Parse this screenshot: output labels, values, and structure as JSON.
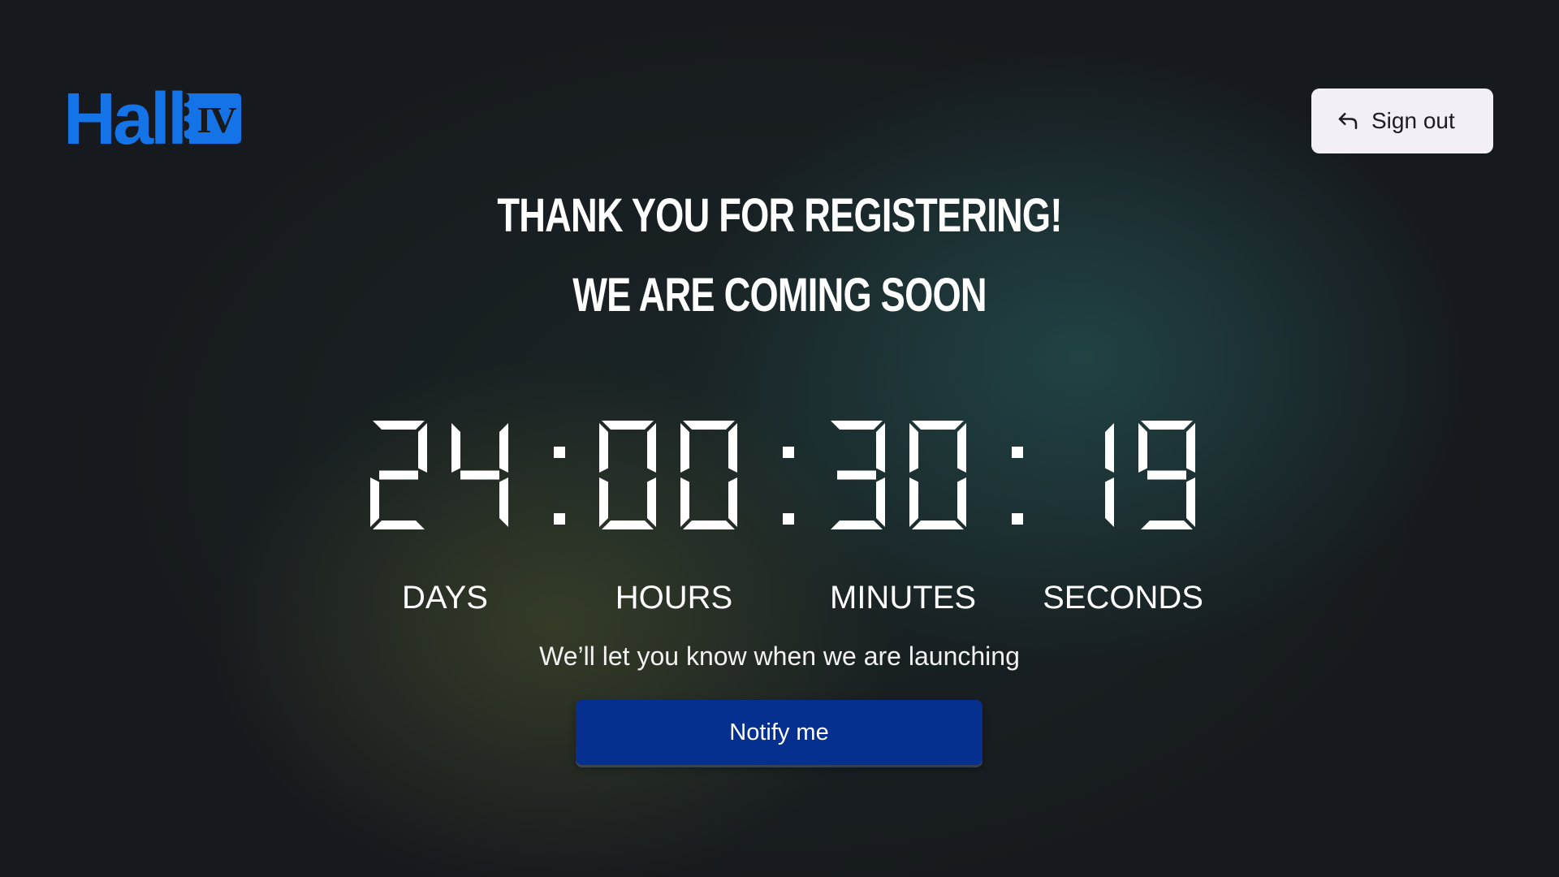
{
  "brand": {
    "name": "Hall",
    "badge": "IV",
    "color": "#1473e6"
  },
  "header": {
    "signout_label": "Sign out",
    "signout_icon": "undo-arrow-icon"
  },
  "headline": {
    "line1": "THANK YOU FOR REGISTERING!",
    "line2": "WE ARE COMING SOON"
  },
  "countdown": {
    "days": "24",
    "hours": "00",
    "minutes": "30",
    "seconds": "19",
    "separator": ":",
    "labels": {
      "days": "DAYS",
      "hours": "HOURS",
      "minutes": "MINUTES",
      "seconds": "SECONDS"
    }
  },
  "subtitle": "We’ll let you know when we are launching",
  "notify": {
    "label": "Notify me",
    "color": "#05308f"
  },
  "colors": {
    "background": "#16191d",
    "signout_background": "#f3eff6"
  }
}
